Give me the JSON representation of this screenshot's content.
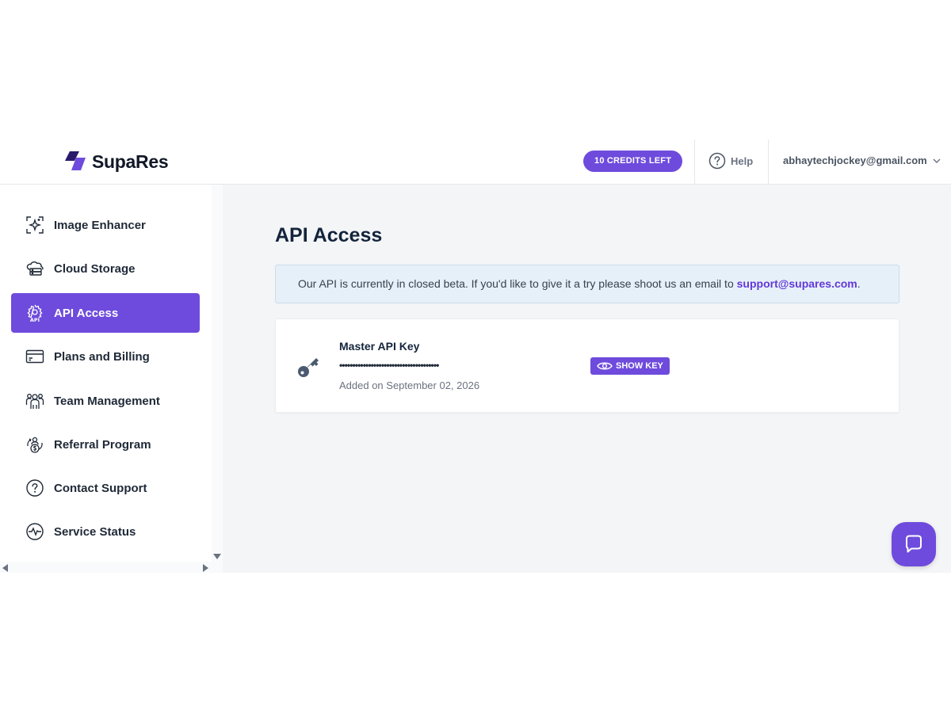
{
  "header": {
    "brand": "SupaRes",
    "credits_label": "10 CREDITS LEFT",
    "help_label": "Help",
    "user_email": "abhaytechjockey@gmail.com"
  },
  "sidebar": {
    "items": [
      {
        "label": "Image Enhancer",
        "icon": "sparkle-frame-icon",
        "active": false
      },
      {
        "label": "Cloud Storage",
        "icon": "cloud-storage-icon",
        "active": false
      },
      {
        "label": "API Access",
        "icon": "api-gear-icon",
        "active": true
      },
      {
        "label": "Plans and Billing",
        "icon": "credit-card-icon",
        "active": false
      },
      {
        "label": "Team Management",
        "icon": "team-icon",
        "active": false
      },
      {
        "label": "Referral Program",
        "icon": "referral-icon",
        "active": false
      },
      {
        "label": "Contact Support",
        "icon": "question-circle-icon",
        "active": false
      },
      {
        "label": "Service Status",
        "icon": "pulse-icon",
        "active": false
      }
    ]
  },
  "main": {
    "title": "API Access",
    "banner": {
      "text": "Our API is currently in closed beta. If you'd like to give it a try please shoot us an email to ",
      "email": "support@supares.com",
      "suffix": "."
    },
    "api_key": {
      "title": "Master API Key",
      "masked": "••••••••••••••••••••••••••••••••••••••",
      "show_label": "SHOW KEY",
      "added": "Added on September 02, 2026"
    }
  },
  "colors": {
    "accent": "#6e4bdc",
    "title": "#13243b",
    "banner_bg": "#e6f0f8",
    "main_bg": "#f4f5f7"
  }
}
